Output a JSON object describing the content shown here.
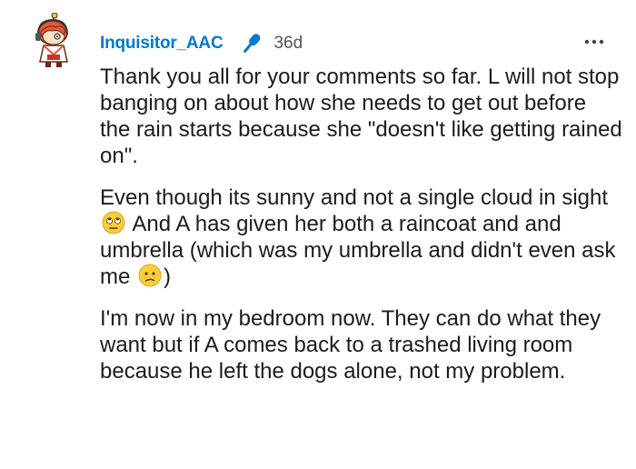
{
  "comment": {
    "username": "Inquisitor_AAC",
    "flair_icon": "microphone-icon",
    "time_ago": "36d",
    "more_icon": "ellipsis-icon",
    "avatar_icon": "avatar-icon",
    "paragraphs": [
      {
        "text": "Thank you all for your comments so far. L will not stop banging on about how she needs to get out before the rain starts because she \"doesn't like getting rained on\"."
      },
      {
        "part1": "Even though its sunny and not a single cloud in sight ",
        "emoji1": "eye-roll-emoji",
        "part2": " And A has given her both a raincoat and and umbrella (which was my umbrella and didn't even ask me ",
        "emoji2": "confused-face-emoji",
        "part3": ")"
      },
      {
        "text": "I'm now in my bedroom now. They can do what they want but if A comes back to a trashed living room because he left the dogs alone, not my problem."
      }
    ]
  },
  "colors": {
    "username": "#0079d3",
    "mic": "#0079d3",
    "text": "#1c1c1c",
    "meta": "#555555"
  }
}
